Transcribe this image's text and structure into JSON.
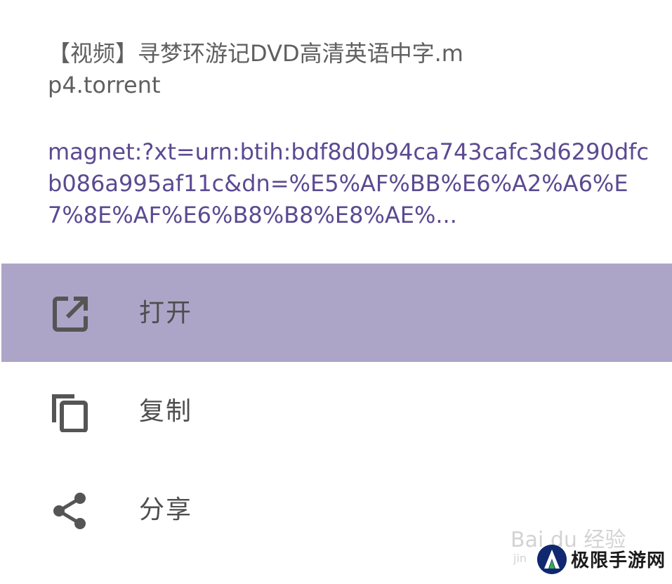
{
  "dialog": {
    "file_name": "【视频】寻梦环游记DVD高清英语中字.mp4.torrent",
    "magnet_link": "magnet:?xt=urn:btih:bdf8d0b94ca743cafc3d6290dfcb086a995af11c&dn=%E5%AF%BB%E6%A2%A6%E7%8E%AF%E6%B8%B8%E8%AE%..."
  },
  "menu": {
    "items": [
      {
        "label": "打开",
        "icon": "open-external-icon",
        "active": true
      },
      {
        "label": "复制",
        "icon": "copy-icon",
        "active": false
      },
      {
        "label": "分享",
        "icon": "share-icon",
        "active": false
      }
    ]
  },
  "watermark": {
    "baidu": "Bai du 经验",
    "baidu_sub": "jin",
    "site": "极限手游网"
  },
  "colors": {
    "active_row": "#ada5c8",
    "link": "#5b4a91",
    "text": "#4e4e4e"
  }
}
